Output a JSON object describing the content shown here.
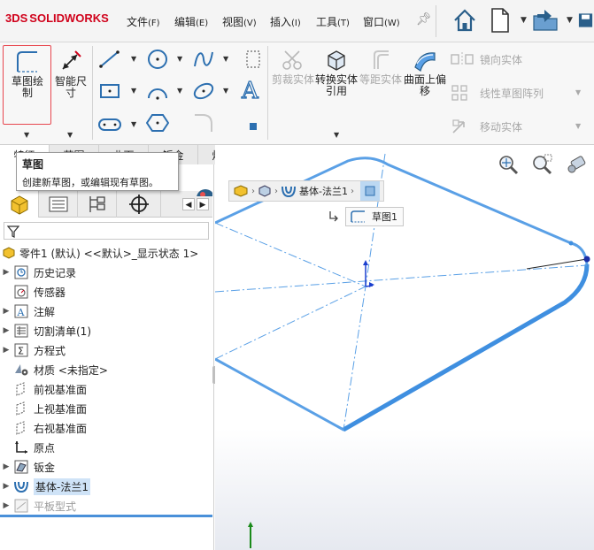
{
  "app": {
    "logo_ds": "3DS",
    "logo_name": "SOLIDWORKS"
  },
  "menu": [
    {
      "label": "文件",
      "accel": "(F)"
    },
    {
      "label": "编辑",
      "accel": "(E)"
    },
    {
      "label": "视图",
      "accel": "(V)"
    },
    {
      "label": "插入",
      "accel": "(I)"
    },
    {
      "label": "工具",
      "accel": "(T)"
    },
    {
      "label": "窗口",
      "accel": "(W)"
    }
  ],
  "ribbon": {
    "sketch": "草图绘制",
    "smart_dim": "智能尺寸",
    "trim": "剪裁实体",
    "convert": "转换实体引用",
    "offset": "等距实体",
    "surface_offset": "曲面上偏移",
    "mirror": "镜向实体",
    "linear_pattern": "线性草图阵列",
    "move": "移动实体"
  },
  "tabs": [
    "特征",
    "草图",
    "曲面",
    "钣金",
    "焊件",
    "标注"
  ],
  "tooltip": {
    "title": "草图",
    "desc": "创建新草图，或编辑现有草图。"
  },
  "tree": {
    "root": "零件1 (默认) <<默认>_显示状态 1>",
    "items": [
      {
        "label": "历史记录",
        "expandable": true
      },
      {
        "label": "传感器",
        "expandable": false
      },
      {
        "label": "注解",
        "expandable": true
      },
      {
        "label": "切割清单(1)",
        "expandable": true
      },
      {
        "label": "方程式",
        "expandable": true
      },
      {
        "label": "材质 <未指定>",
        "expandable": false
      },
      {
        "label": "前视基准面",
        "expandable": false
      },
      {
        "label": "上视基准面",
        "expandable": false
      },
      {
        "label": "右视基准面",
        "expandable": false
      },
      {
        "label": "原点",
        "expandable": false
      },
      {
        "label": "钣金",
        "expandable": true
      },
      {
        "label": "基体-法兰1",
        "expandable": true
      },
      {
        "label": "平板型式",
        "expandable": true
      }
    ]
  },
  "breadcrumb": {
    "feature": "基体-法兰1",
    "sketch": "草图1"
  },
  "colors": {
    "accent": "#4a90d9",
    "sketch_line": "#5aa0e6",
    "highlight": "#e8474f",
    "logo": "#d0021b"
  }
}
